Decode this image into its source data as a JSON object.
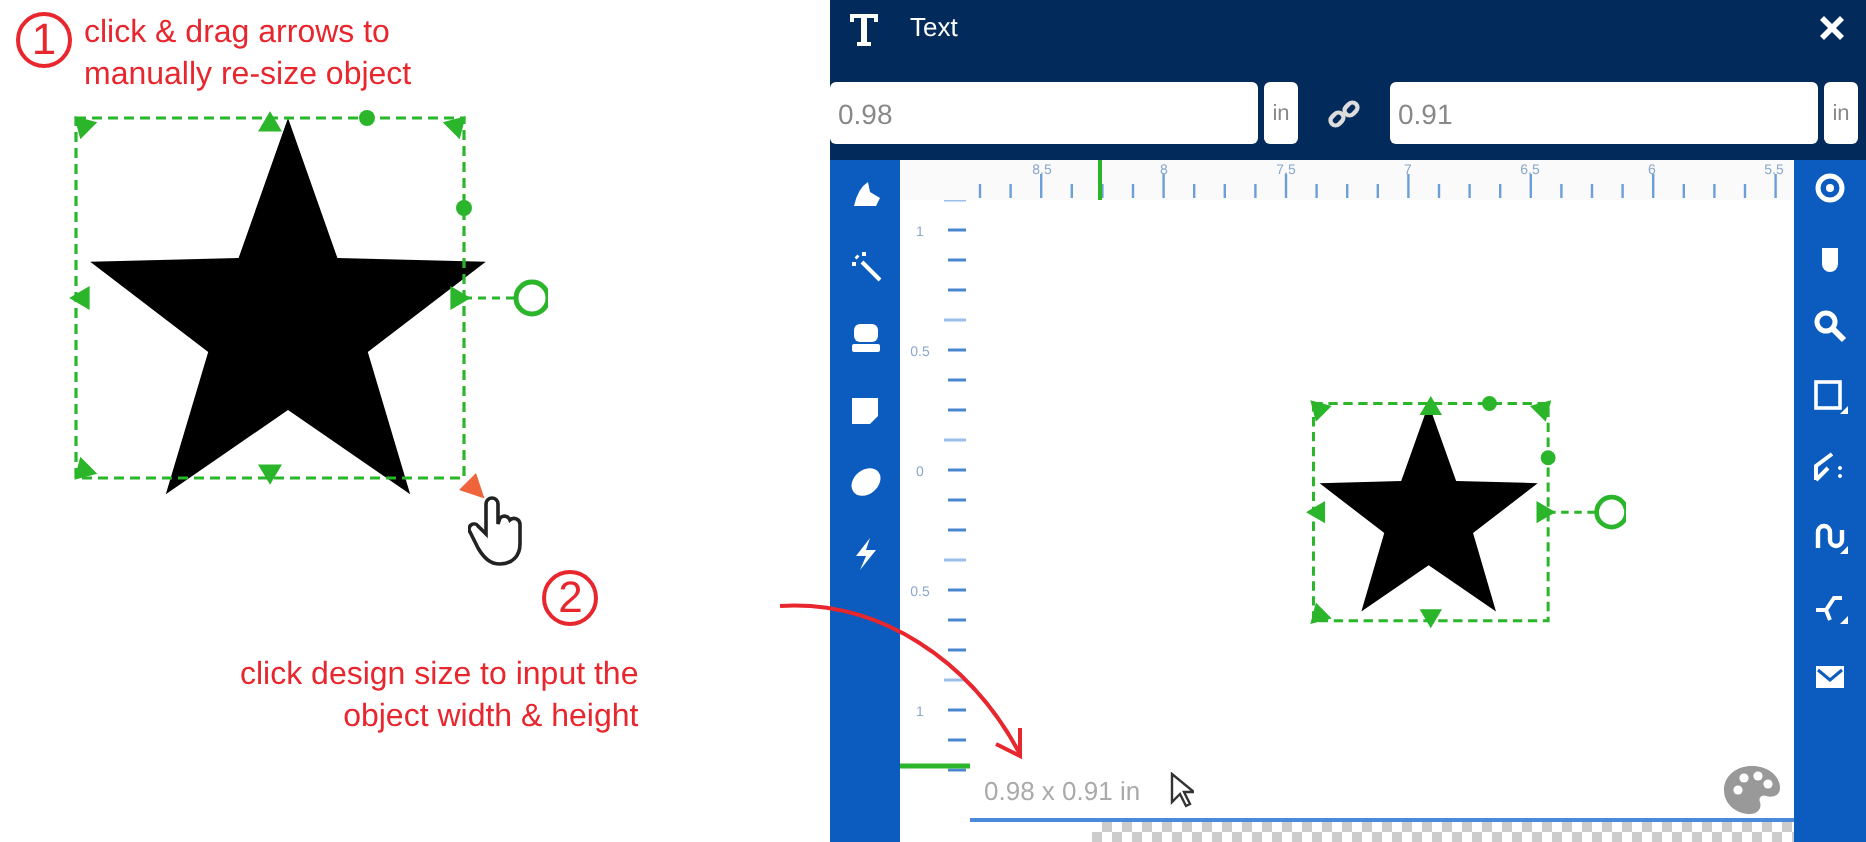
{
  "step_1": {
    "number": "1",
    "text": "click & drag arrows to\nmanually re-size object"
  },
  "step_2": {
    "number": "2",
    "text": "click design size to input the\nobject width & height"
  },
  "window": {
    "title": "Text",
    "width": {
      "value": "0.98",
      "unit": "in"
    },
    "height": {
      "value": "0.91",
      "unit": "in"
    }
  },
  "ruler": {
    "horizontal_labels": [
      "8.5",
      "8",
      "7.5",
      "7",
      "6.5",
      "6",
      "5.5"
    ],
    "vertical_labels": [
      "1",
      "0.5",
      "0",
      "0.5",
      "1"
    ]
  },
  "design_size": "0.98 x 0.91 in"
}
